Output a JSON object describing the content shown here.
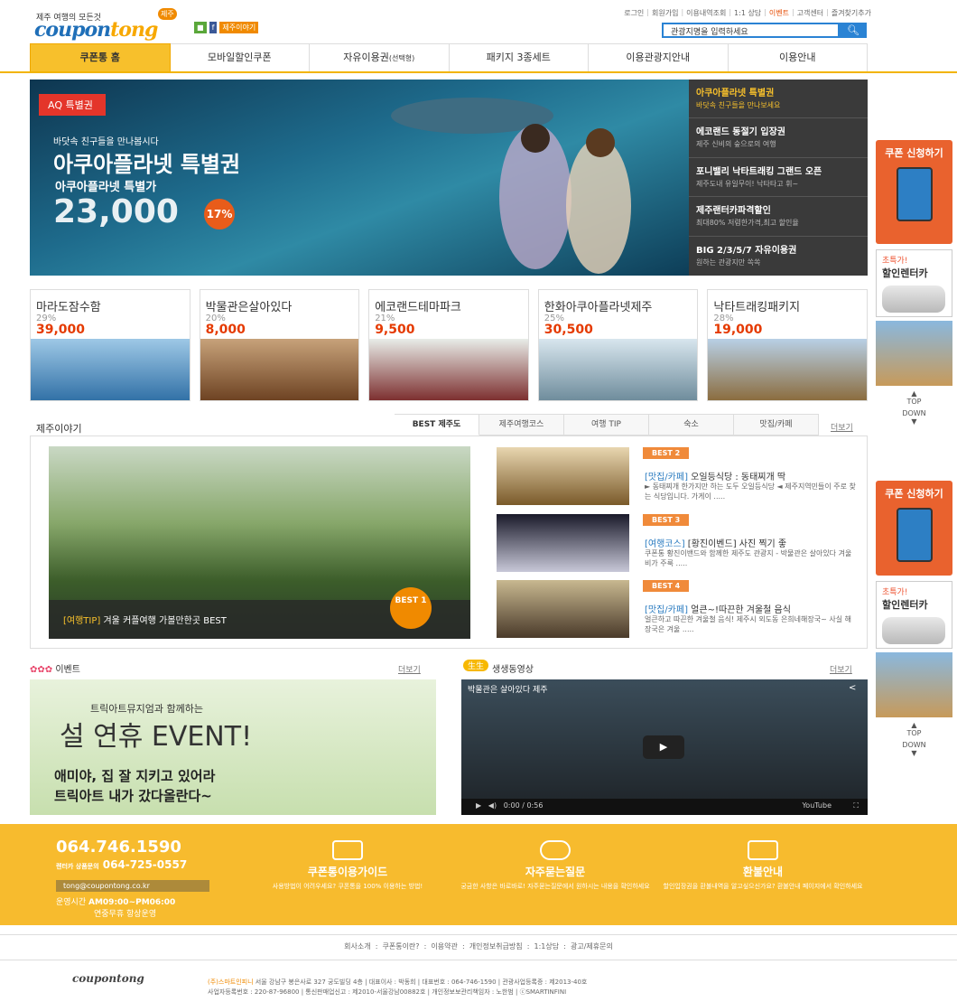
{
  "header": {
    "tagline": "제주 여행의 모든것",
    "badge": "제주",
    "logo_a": "coupon",
    "logo_b": "tong",
    "sns_facebook": "f",
    "sns_story": "제주이야기",
    "top_links": [
      "로그인",
      "회원가입",
      "이용내역조회",
      "1:1 상담",
      "이벤트",
      "고객센터",
      "즐겨찾기추가"
    ],
    "search_placeholder": "관광지명을 입력하세요"
  },
  "nav": {
    "tabs": [
      "쿠폰통 홈",
      "모바일할인쿠폰",
      "자유이용권",
      "패키지 3종세트",
      "이용관광지안내",
      "이용안내"
    ],
    "free_sub": "(선택형)"
  },
  "hero": {
    "tag": "AQ 특별권",
    "sub": "바닷속 친구들을 만나봅시다",
    "title": "아쿠아플라넷 특별권",
    "sub2": "아쿠아플라넷 특별가",
    "price": "23,000",
    "discount": "17%",
    "list": [
      {
        "title": "아쿠아플라넷 특별권",
        "sub": "바닷속 친구들을 만나보세요"
      },
      {
        "title": "에코랜드 동절기 입장권",
        "sub": "제주 신비의 숲으로의 여행"
      },
      {
        "title": "포니밸리 낙타트래킹 그랜드 오픈",
        "sub": "제주도내 유일무이! 낙타타고 휘~"
      },
      {
        "title": "제주랜터카파격할인",
        "sub": "최대80% 저렴한가격,최고 할인율"
      },
      {
        "title": "BIG 2/3/5/7 자유이용권",
        "sub": "원하는 관광지만 쏙쏙"
      }
    ]
  },
  "products": [
    {
      "name": "마라도잠수함",
      "pct": "29%",
      "price": "39,000"
    },
    {
      "name": "박물관은살아있다",
      "pct": "20%",
      "price": "8,000"
    },
    {
      "name": "에코랜드테마파크",
      "pct": "21%",
      "price": "9,500"
    },
    {
      "name": "한화아쿠아플라넷제주",
      "pct": "25%",
      "price": "30,500"
    },
    {
      "name": "낙타트래킹패키지",
      "pct": "28%",
      "price": "19,000"
    }
  ],
  "right": {
    "coupon": "쿠폰 신청하기",
    "rent_a": "초특가!",
    "rent_b": "할인렌터카",
    "top": "TOP",
    "down": "DOWN"
  },
  "story": {
    "title": "제주이야기",
    "tabs": [
      "BEST 제주도",
      "제주여행코스",
      "여행 TIP",
      "숙소",
      "맛집/카페"
    ],
    "more": "더보기",
    "main_cat": "[여행TIP]",
    "main_text": "겨울 커플여행 가볼만한곳 BEST",
    "best_label": "BEST 1",
    "items": [
      {
        "badge": "BEST 2",
        "cat": "[맛집/카페]",
        "title": "오일등식당 : 동태찌개 딱",
        "desc": "► 동태찌개 한가지만 하는 도두 오일등식당 ◄ 제주지역민들이 주로 찾는 식당입니다. 가게이 ....."
      },
      {
        "badge": "BEST 3",
        "cat": "[여행코스]",
        "title": "[황진이벤드] 사진 찍기 좋",
        "desc": "쿠폰통 황진이밴드와 함께한 제주도 관광지 - 박물관은 살아있다 겨울비가 주룩 ....."
      },
      {
        "badge": "BEST 4",
        "cat": "[맛집/카페]",
        "title": "얼큰~!따끈한 겨울철 음식",
        "desc": "얼큰하고 따끈한 겨울철 음식! 제주시 외도동 은희네해장국~ 사실 해장국은 겨울 ....."
      }
    ]
  },
  "event": {
    "title": "이벤트",
    "more": "더보기",
    "l1": "트릭아트뮤지엄과 함께하는",
    "l2": "설 연휴 EVENT!",
    "l3": "애미야, 집 잘 지키고 있어라",
    "l4": "트릭아트 내가 갔다올란다~"
  },
  "video": {
    "badge": "生生",
    "title": "생생동영상",
    "more": "더보기",
    "caption": "박물관은 살아있다 제주",
    "time": "0:00 / 0:56",
    "brand": "YouTube"
  },
  "band": {
    "phone": "064.746.1590",
    "phone2_label": "렌터카 상품문의",
    "phone2": "064-725-0557",
    "email": "tong@coupontong.co.kr",
    "hours_label": "운영시간",
    "hours": "AM09:00~PM06:00",
    "hours_sub": "연중무휴 항상운영",
    "guide_t": "쿠폰통이용가이드",
    "guide_d": "사용방법이 어려우세요? 쿠폰통을 100% 이용하는 방법!",
    "faq_t": "자주묻는질문",
    "faq_d": "궁금한 사항은 바로바로! 자주묻는질문에서 원하시는 내용을 확인하세요",
    "refund_t": "환불안내",
    "refund_d": "할인입장권을 환불내역을 알고싶으신가요? 환불안내 페이지에서 확인하세요"
  },
  "footer": {
    "links": [
      "회사소개",
      "쿠폰통이란?",
      "이용약관",
      "개인정보취급방침",
      "1:1상담",
      "광고/제휴문의"
    ],
    "logo": "coupontong",
    "company": "(주)스마트인피니",
    "addr1": "서울 강남구 봉은사로 327 궁도빌딩 4층 | 대표이사 : 박동희 | 대표번호 : 064-746-1590 | 관광사업등록증 : 제2013-40호",
    "addr2": "사업자등록번호 : 220-87-96800 | 통신판매업신고 : 제2010-서울강남00882호 | 개인정보보관리책임자 : 노한범 | ⓒSMARTINFINI"
  },
  "colors": {
    "accent": "#f7bb2e",
    "brand_blue": "#1f6fb8",
    "price_red": "#e53a00"
  }
}
